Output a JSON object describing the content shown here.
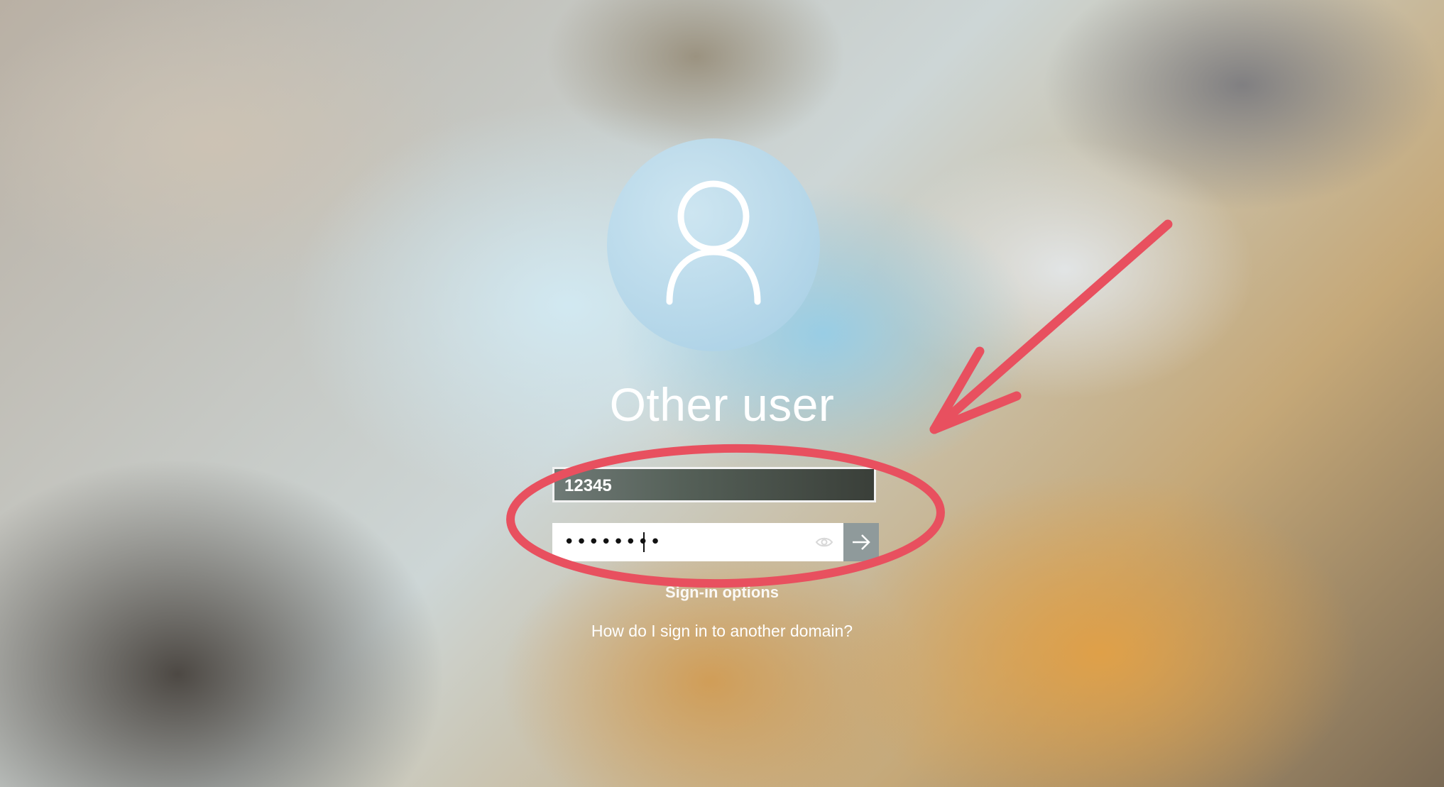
{
  "login": {
    "display_name": "Other user",
    "username_value": "12345",
    "password_masked": "••••••••",
    "sign_in_options_label": "Sign-in options",
    "other_domain_link": "How do I sign in to another domain?"
  },
  "icons": {
    "avatar": "user-icon",
    "password_reveal": "eye-icon",
    "submit": "arrow-right-icon"
  },
  "annotation": {
    "color": "#e8505f"
  }
}
